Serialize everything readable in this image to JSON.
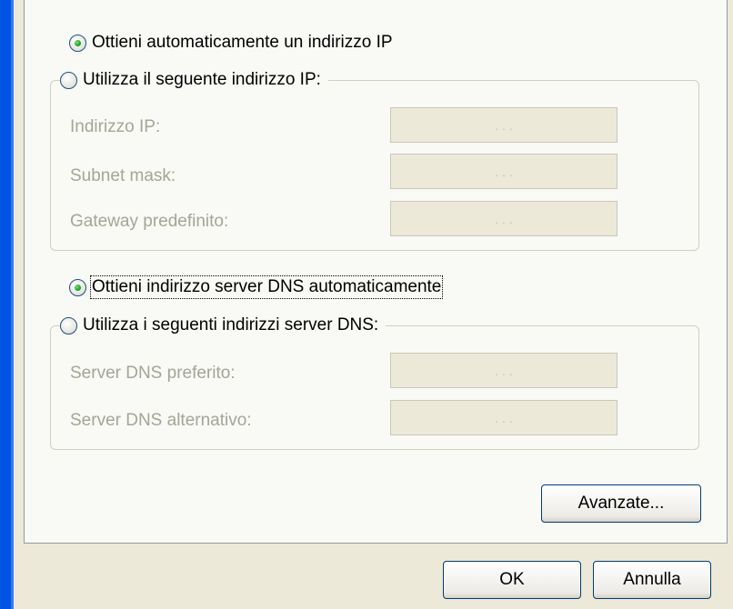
{
  "ip": {
    "auto_label": "Ottieni automaticamente un indirizzo IP",
    "manual_label": "Utilizza il seguente indirizzo IP:",
    "fields": [
      {
        "label": "Indirizzo IP:",
        "value": ". . ."
      },
      {
        "label": "Subnet mask:",
        "value": ". . ."
      },
      {
        "label": "Gateway predefinito:",
        "value": ". . ."
      }
    ]
  },
  "dns": {
    "auto_label": "Ottieni indirizzo server DNS automaticamente",
    "manual_label": "Utilizza i seguenti indirizzi server DNS:",
    "fields": [
      {
        "label": "Server DNS preferito:",
        "value": ". . ."
      },
      {
        "label": "Server DNS alternativo:",
        "value": ". . ."
      }
    ]
  },
  "buttons": {
    "advanced": "Avanzate...",
    "ok": "OK",
    "cancel": "Annulla"
  },
  "colors": {
    "window_frame": "#0054e3",
    "dialog_bg": "#ece9d8",
    "panel_bg": "#f9f9f6",
    "disabled_text": "#a5a597"
  }
}
